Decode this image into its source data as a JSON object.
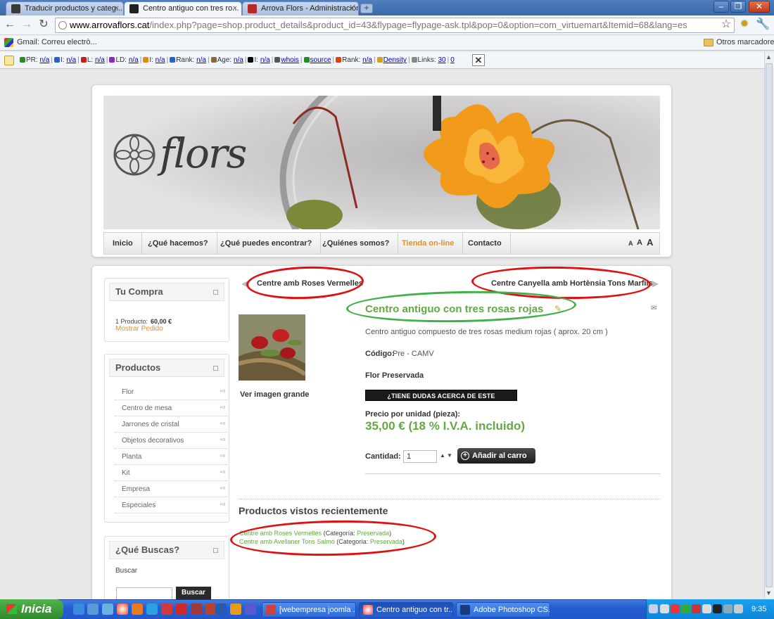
{
  "browser": {
    "tabs": [
      {
        "label": "Traducir productos y categ...",
        "icon_color": "#3b3b3b"
      },
      {
        "label": "Centro antiguo con tres ro...",
        "icon_color": "#222222"
      },
      {
        "label": "Arrova Flors - Administración",
        "icon_color": "#b52a2a"
      }
    ],
    "close_glyph": "×",
    "new_tab_glyph": "+",
    "url_host": "www.arrovaflors.cat",
    "url_path": "/index.php?page=shop.product_details&product_id=43&flypage=flypage-ask.tpl&pop=0&option=com_virtuemart&Itemid=68&lang=es",
    "bookmark_gmail": "Gmail: Correu electrò...",
    "bookmark_other": "Otros marcadores"
  },
  "seo_bar": {
    "items": [
      {
        "label": "PR:",
        "value": "n/a",
        "color": "#2a8a2a"
      },
      {
        "label": "I:",
        "value": "n/a",
        "color": "#2a5fcc"
      },
      {
        "label": "L:",
        "value": "n/a",
        "color": "#c02020"
      },
      {
        "label": "LD:",
        "value": "n/a",
        "color": "#8a2ac0"
      },
      {
        "label": "I:",
        "value": "n/a",
        "color": "#e08a10"
      },
      {
        "label": "Rank:",
        "value": "n/a",
        "color": "#2a5fcc"
      },
      {
        "label": "Age:",
        "value": "n/a",
        "color": "#8a6a3a"
      },
      {
        "label": "I:",
        "value": "n/a",
        "color": "#000000"
      },
      {
        "label": "",
        "value": "whois",
        "color": "#555555"
      },
      {
        "label": "",
        "value": "source",
        "color": "#2a8a2a"
      },
      {
        "label": "Rank:",
        "value": "n/a",
        "color": "#e04010"
      },
      {
        "label": "",
        "value": "Density",
        "color": "#d0a020"
      },
      {
        "label": "Links:",
        "value": "30",
        "value2": "0",
        "color": "#888888"
      }
    ],
    "close_glyph": "✕"
  },
  "site": {
    "logo_text": "flors",
    "nav": [
      {
        "label": "Inicio"
      },
      {
        "label": "¿Qué hacemos?"
      },
      {
        "label": "¿Qué puedes encontrar?"
      },
      {
        "label": "¿Quiénes somos?"
      },
      {
        "label": "Tienda on-line"
      },
      {
        "label": "Contacto"
      }
    ],
    "font_sizer": [
      "A",
      "A",
      "A"
    ]
  },
  "sidebar": {
    "cart": {
      "title": "Tu Compra",
      "summary_prefix": "1 Producto:",
      "summary_amount": "60,00 €",
      "show_order": "Mostrar Pedido"
    },
    "products": {
      "title": "Productos",
      "items": [
        "Flor",
        "Centro de mesa",
        "Jarrones de cristal",
        "Objetos decorativos",
        "Planta",
        "Kit",
        "Empresa",
        "Especiales"
      ]
    },
    "search": {
      "title": "¿Qué Buscas?",
      "label": "Buscar",
      "button": "Buscar"
    }
  },
  "product": {
    "prev": "Centre amb Roses Vermelles",
    "next": "Centre Canyella amb Hortènsia Tons Marfils",
    "title": "Centro antiguo con tres rosas rojas",
    "description": "Centro antiguo compuesto de tres rosas medium rojas ( aprox. 20 cm )",
    "code_label": "Código:",
    "code_value": "Pre - CAMV",
    "category": "Flor Preservada",
    "ask_button": "¿TIENE DUDAS ACERCA DE ESTE PRODUCTO?",
    "view_large": "Ver imagen grande",
    "price_label": "Precio por unidad (pieza):",
    "price": "35,00 € (18 % I.V.A. incluido)",
    "qty_label": "Cantidad:",
    "qty_value": "1",
    "add_to_cart": "Añadir al carro"
  },
  "recent": {
    "title": "Productos vistos recientemente",
    "items": [
      {
        "name": "Centre amb Roses Vermelles",
        "cat_label": "(Categoría:",
        "cat_value": "Preservada",
        "close": ")"
      },
      {
        "name": "Centre amb Avellaner Tons Salmó",
        "cat_label": "(Categoría:",
        "cat_value": "Preservada",
        "close": ")"
      }
    ]
  },
  "taskbar": {
    "start": "Inicia",
    "tasks": [
      {
        "label": "[webempresa joomla ...",
        "icon_color": "#d04040"
      },
      {
        "label": "Centro antiguo con tr...",
        "icon_color": "#f0f0f0"
      },
      {
        "label": "Adobe Photoshop CS...",
        "icon_color": "#1a3a80"
      }
    ],
    "clock": "9:35"
  },
  "colors": {
    "accent_green": "#64a844",
    "accent_orange": "#e0902a",
    "annotation_red": "#e01010",
    "annotation_green": "#3fb14a"
  }
}
